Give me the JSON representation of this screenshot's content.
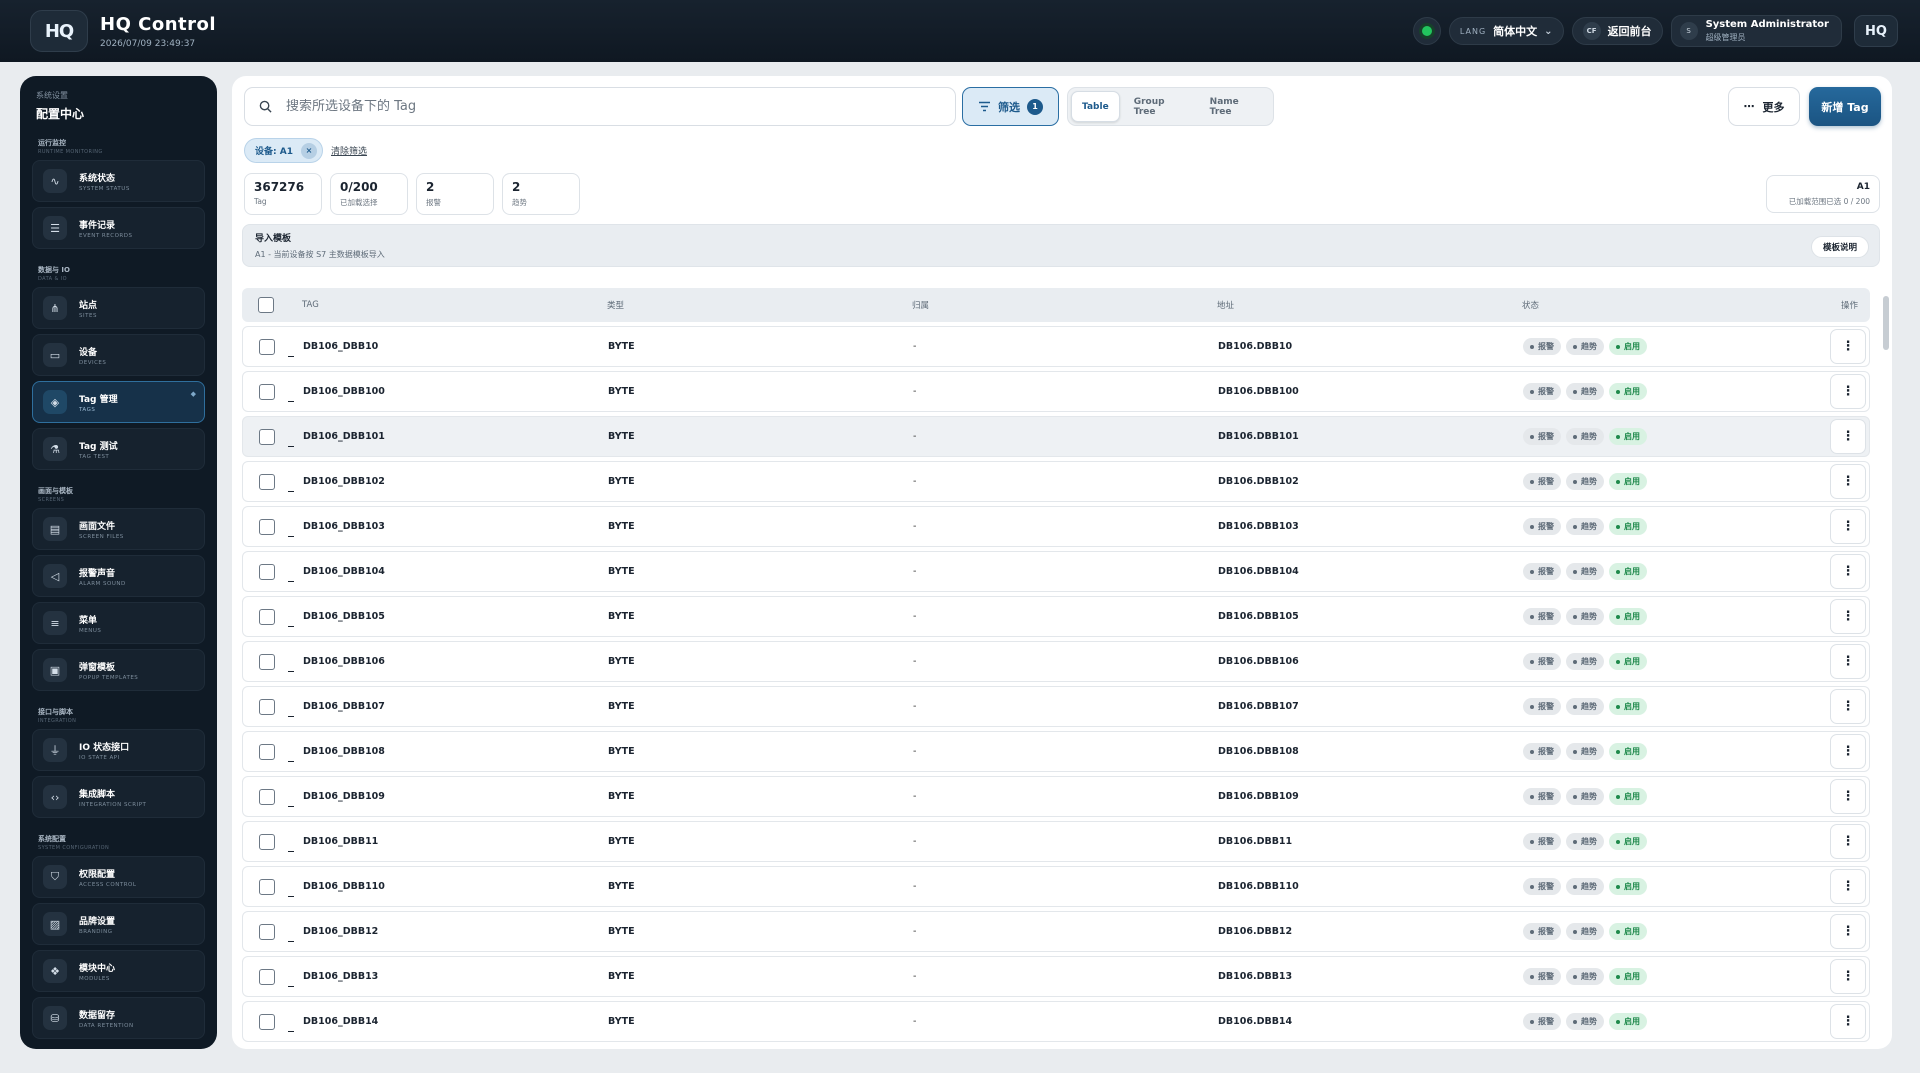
{
  "app": {
    "logo_text": "HQ",
    "title": "HQ Control",
    "datetime": "2026/07/09 23:49:37",
    "lang_label": "LANG",
    "lang_value": "简体中文",
    "cf_badge": "CF",
    "back_label": "返回前台",
    "user_initial": "S",
    "user_name": "System Administrator",
    "user_role": "超级管理员",
    "status_color": "#22c55e"
  },
  "sidebar": {
    "eyebrow": "系统设置",
    "title": "配置中心",
    "groups": [
      {
        "title": "运行监控",
        "subtitle": "RUNTIME MONITORING",
        "items": [
          {
            "label": "系统状态",
            "sub": "SYSTEM STATUS",
            "icon": "activity-icon"
          },
          {
            "label": "事件记录",
            "sub": "EVENT RECORDS",
            "icon": "list-icon"
          }
        ]
      },
      {
        "title": "数据与 IO",
        "subtitle": "DATA & IO",
        "items": [
          {
            "label": "站点",
            "sub": "SITES",
            "icon": "network-icon"
          },
          {
            "label": "设备",
            "sub": "DEVICES",
            "icon": "monitor-icon"
          },
          {
            "label": "Tag 管理",
            "sub": "TAGS",
            "icon": "tag-icon",
            "active": true
          },
          {
            "label": "Tag 测试",
            "sub": "TAG TEST",
            "icon": "flask-icon"
          }
        ]
      },
      {
        "title": "画面与模板",
        "subtitle": "SCREENS",
        "items": [
          {
            "label": "画面文件",
            "sub": "SCREEN FILES",
            "icon": "file-icon"
          },
          {
            "label": "报警声音",
            "sub": "ALARM SOUND",
            "icon": "speaker-icon"
          },
          {
            "label": "菜单",
            "sub": "MENUS",
            "icon": "menu-icon"
          },
          {
            "label": "弹窗模板",
            "sub": "POPUP TEMPLATES",
            "icon": "window-icon"
          }
        ]
      },
      {
        "title": "接口与脚本",
        "subtitle": "INTEGRATION",
        "items": [
          {
            "label": "IO 状态接口",
            "sub": "IO STATE API",
            "icon": "plug-icon"
          },
          {
            "label": "集成脚本",
            "sub": "INTEGRATION SCRIPT",
            "icon": "code-icon"
          }
        ]
      },
      {
        "title": "系统配置",
        "subtitle": "SYSTEM CONFIGURATION",
        "items": [
          {
            "label": "权限配置",
            "sub": "ACCESS CONTROL",
            "icon": "shield-icon"
          },
          {
            "label": "品牌设置",
            "sub": "BRANDING",
            "icon": "image-icon"
          },
          {
            "label": "模块中心",
            "sub": "MODULES",
            "icon": "modules-icon"
          },
          {
            "label": "数据留存",
            "sub": "DATA RETENTION",
            "icon": "database-icon"
          }
        ]
      }
    ]
  },
  "toolbar": {
    "search_placeholder": "搜索所选设备下的 Tag",
    "filter_label": "筛选",
    "filter_count": "1",
    "tabs": [
      "Table",
      "Group Tree",
      "Name Tree"
    ],
    "active_tab": "Table",
    "more_label": "更多",
    "add_label": "新增 Tag"
  },
  "filters": {
    "chip_label": "设备: A1",
    "clear_label": "清除筛选"
  },
  "stats": [
    {
      "value": "367276",
      "label": "Tag"
    },
    {
      "value": "0/200",
      "label": "已加载选择"
    },
    {
      "value": "2",
      "label": "报警"
    },
    {
      "value": "2",
      "label": "趋势"
    }
  ],
  "scope": {
    "value": "A1",
    "label": "已加载范围已选 0 / 200"
  },
  "import": {
    "title": "导入模板",
    "desc": "A1 - 当前设备按 S7 主数据模板导入",
    "button": "模板说明"
  },
  "table": {
    "columns": [
      "TAG",
      "类型",
      "归属",
      "地址",
      "状态",
      "操作"
    ],
    "status_pills": [
      "报警",
      "趋势",
      "启用"
    ],
    "rows": [
      {
        "tag": "DB106_DBB10",
        "type": "BYTE",
        "owner": "-",
        "address": "DB106.DBB10"
      },
      {
        "tag": "DB106_DBB100",
        "type": "BYTE",
        "owner": "-",
        "address": "DB106.DBB100"
      },
      {
        "tag": "DB106_DBB101",
        "type": "BYTE",
        "owner": "-",
        "address": "DB106.DBB101",
        "highlight": true
      },
      {
        "tag": "DB106_DBB102",
        "type": "BYTE",
        "owner": "-",
        "address": "DB106.DBB102"
      },
      {
        "tag": "DB106_DBB103",
        "type": "BYTE",
        "owner": "-",
        "address": "DB106.DBB103"
      },
      {
        "tag": "DB106_DBB104",
        "type": "BYTE",
        "owner": "-",
        "address": "DB106.DBB104"
      },
      {
        "tag": "DB106_DBB105",
        "type": "BYTE",
        "owner": "-",
        "address": "DB106.DBB105"
      },
      {
        "tag": "DB106_DBB106",
        "type": "BYTE",
        "owner": "-",
        "address": "DB106.DBB106"
      },
      {
        "tag": "DB106_DBB107",
        "type": "BYTE",
        "owner": "-",
        "address": "DB106.DBB107"
      },
      {
        "tag": "DB106_DBB108",
        "type": "BYTE",
        "owner": "-",
        "address": "DB106.DBB108"
      },
      {
        "tag": "DB106_DBB109",
        "type": "BYTE",
        "owner": "-",
        "address": "DB106.DBB109"
      },
      {
        "tag": "DB106_DBB11",
        "type": "BYTE",
        "owner": "-",
        "address": "DB106.DBB11"
      },
      {
        "tag": "DB106_DBB110",
        "type": "BYTE",
        "owner": "-",
        "address": "DB106.DBB110"
      },
      {
        "tag": "DB106_DBB12",
        "type": "BYTE",
        "owner": "-",
        "address": "DB106.DBB12"
      },
      {
        "tag": "DB106_DBB13",
        "type": "BYTE",
        "owner": "-",
        "address": "DB106.DBB13"
      },
      {
        "tag": "DB106_DBB14",
        "type": "BYTE",
        "owner": "-",
        "address": "DB106.DBB14"
      }
    ]
  }
}
